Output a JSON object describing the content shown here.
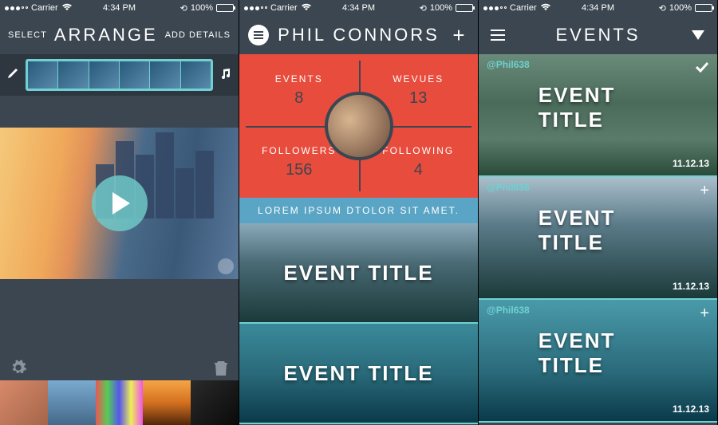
{
  "statusbar": {
    "carrier": "Carrier",
    "time": "4:34 PM",
    "battery": "100%"
  },
  "screen1": {
    "nav": {
      "left": "SELECT",
      "title": "ARRANGE",
      "right": "ADD DETAILS"
    }
  },
  "screen2": {
    "nav": {
      "title": "PHIL CONNORS"
    },
    "stats": {
      "events": {
        "label": "EVENTS",
        "value": "8"
      },
      "wevues": {
        "label": "WEVUES",
        "value": "13"
      },
      "followers": {
        "label": "FOLLOWERS",
        "value": "156"
      },
      "following": {
        "label": "FOLLOWING",
        "value": "4"
      }
    },
    "bio": "LOREM IPSUM DTOLOR SIT AMET.",
    "cards": [
      {
        "title": "EVENT TITLE"
      },
      {
        "title": "EVENT TITLE"
      }
    ]
  },
  "screen3": {
    "nav": {
      "title": "EVENTS"
    },
    "cards": [
      {
        "handle": "@Phil638",
        "title": "EVENT TITLE",
        "date": "11.12.13",
        "corner": "check"
      },
      {
        "handle": "@Phil638",
        "title": "EVENT TITLE",
        "date": "11.12.13",
        "corner": "plus"
      },
      {
        "handle": "@Phil638",
        "title": "EVENT TITLE",
        "date": "11.12.13",
        "corner": "plus"
      }
    ]
  }
}
